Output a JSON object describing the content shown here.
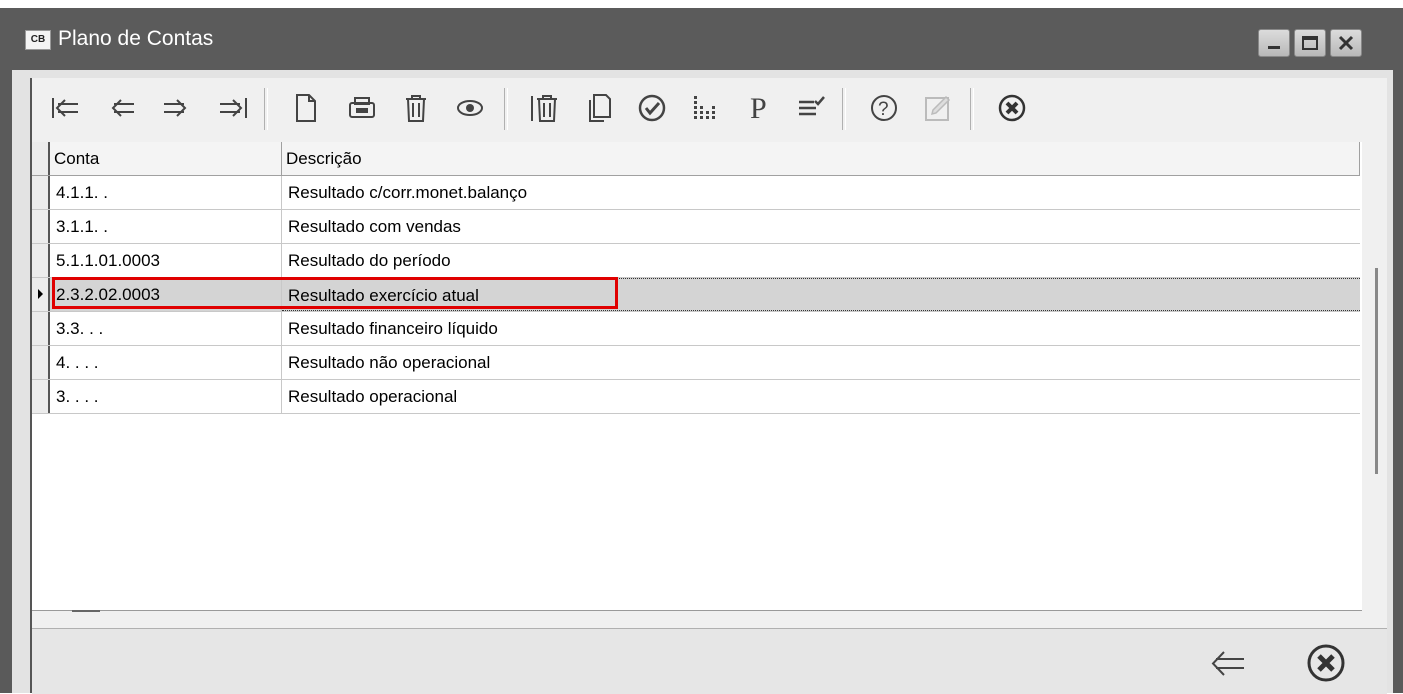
{
  "window": {
    "title": "Plano de Contas",
    "app_icon_label": "CB",
    "controls": [
      "minimize-icon",
      "maximize-icon",
      "close-icon"
    ]
  },
  "toolbar": {
    "buttons": [
      {
        "name": "first-record",
        "icon": "first-arrow-icon"
      },
      {
        "name": "previous-record",
        "icon": "left-arrow-icon"
      },
      {
        "name": "next-record",
        "icon": "right-arrow-icon"
      },
      {
        "name": "last-record",
        "icon": "last-arrow-icon"
      },
      {
        "name": "new-record",
        "icon": "new-document-icon"
      },
      {
        "name": "print-record",
        "icon": "printer-icon"
      },
      {
        "name": "delete-record",
        "icon": "trash-icon"
      },
      {
        "name": "view-record",
        "icon": "eye-icon"
      },
      {
        "name": "delete-all",
        "icon": "trash-bars-icon"
      },
      {
        "name": "copy-record",
        "icon": "copy-icon"
      },
      {
        "name": "confirm",
        "icon": "checkmark-circle-icon"
      },
      {
        "name": "chart",
        "icon": "dotted-chart-icon"
      },
      {
        "name": "parameters",
        "icon": "letter-p-icon"
      },
      {
        "name": "filter-options",
        "icon": "list-check-icon"
      },
      {
        "name": "help",
        "icon": "question-circle-icon"
      },
      {
        "name": "edit",
        "icon": "edit-icon"
      },
      {
        "name": "close-form",
        "icon": "x-circle-icon"
      }
    ],
    "p_letter": "P",
    "help_symbol": "?"
  },
  "grid": {
    "columns": [
      "Conta",
      "Descrição"
    ],
    "rows": [
      {
        "conta": "4.1.1.  .",
        "descricao": "Resultado c/corr.monet.balanço"
      },
      {
        "conta": "3.1.1.  .",
        "descricao": "Resultado com vendas"
      },
      {
        "conta": "5.1.1.01.0003",
        "descricao": "Resultado do período"
      },
      {
        "conta": "2.3.2.02.0003",
        "descricao": "Resultado exercício atual"
      },
      {
        "conta": "3.3. .  .",
        "descricao": "Resultado financeiro líquido"
      },
      {
        "conta": "4. . .  .",
        "descricao": "Resultado não operacional"
      },
      {
        "conta": "3. . .  .",
        "descricao": "Resultado operacional"
      }
    ],
    "selected_row_index": 3
  },
  "bottom_bar": {
    "buttons": [
      {
        "name": "back",
        "icon": "back-arrow-icon"
      },
      {
        "name": "cancel",
        "icon": "x-circle-icon"
      }
    ]
  },
  "colors": {
    "titlebar": "#5b5b5b",
    "highlight": "#e00000",
    "selected_row": "#d4d4d4"
  }
}
